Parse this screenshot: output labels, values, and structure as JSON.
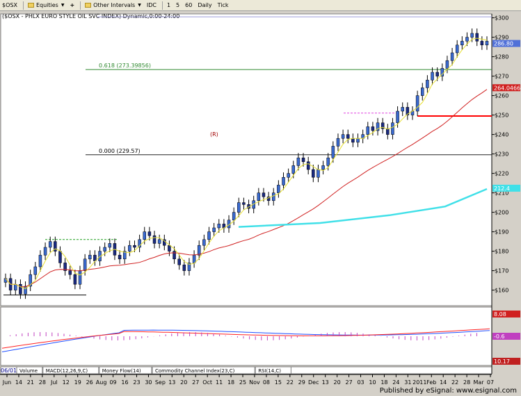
{
  "toolbar": {
    "items": [
      {
        "label": "$OSX",
        "icon": "chart-icon"
      },
      {
        "label": "Equities",
        "icon": "folder-icon",
        "dropdown": true
      },
      {
        "label": "+",
        "icon": "plus-icon"
      },
      {
        "label": "Other Intervals",
        "icon": "folder-icon",
        "dropdown": true
      },
      {
        "label": "IDC",
        "icon": "gear-icon"
      },
      {
        "label": "1"
      },
      {
        "label": "5"
      },
      {
        "label": "60"
      },
      {
        "label": "Daily"
      },
      {
        "label": "Tick"
      }
    ]
  },
  "chart_title": "($OSX - PHLX EURO STYLE OIL SVC INDEX) Dynamic,0:00-24:00",
  "annotations": {
    "fib_618": "0.618 (273.39856)",
    "fib_000": "0.000 (229.57)",
    "bracket_r": "(R)"
  },
  "price_labels": {
    "last": "286.80",
    "ma_short": "264.0466",
    "ma_long": "212.4"
  },
  "macd_labels": {
    "macd": "8.08",
    "hist": "-0.6"
  },
  "volume_label": "10.17",
  "bottom_tabs": [
    "Volume",
    "MACD(12,26,9,C)",
    "Money Flow(14)",
    "Commodity Channel Index(23,C)",
    "RSI(14,C)"
  ],
  "date_start": "06/01/10",
  "x_ticks": [
    "Jun",
    "14",
    "21",
    "28",
    "Jul",
    "12",
    "19",
    "26",
    "Aug",
    "09",
    "16",
    "23",
    "30",
    "Sep",
    "13",
    "20",
    "27",
    "Oct",
    "11",
    "18",
    "25",
    "Nov",
    "08",
    "15",
    "22",
    "29",
    "Dec",
    "13",
    "20",
    "27",
    "03",
    "10",
    "18",
    "24",
    "31",
    "2011",
    "Feb",
    "14",
    "22",
    "28",
    "Mar",
    "07"
  ],
  "y_ticks": [
    160,
    170,
    180,
    190,
    200,
    210,
    220,
    230,
    240,
    250,
    260,
    270,
    280,
    290,
    300
  ],
  "publisher": "Published by eSignal: www.esignal.com",
  "chart_data": {
    "type": "candlestick",
    "title": "($OSX - PHLX EURO STYLE OIL SVC INDEX) Dynamic,0:00-24:00",
    "ylim": [
      152,
      302
    ],
    "x_range": [
      "2010-06-01",
      "2011-03-07"
    ],
    "y_axis_side": "right",
    "grid": false,
    "closes": [
      166,
      160,
      163,
      158,
      162,
      168,
      172,
      178,
      182,
      185,
      180,
      174,
      170,
      168,
      163,
      170,
      176,
      178,
      175,
      180,
      182,
      184,
      178,
      176,
      180,
      183,
      182,
      186,
      190,
      188,
      184,
      186,
      183,
      180,
      176,
      173,
      170,
      174,
      178,
      183,
      186,
      190,
      192,
      194,
      192,
      196,
      200,
      205,
      204,
      202,
      206,
      210,
      208,
      206,
      210,
      214,
      218,
      220,
      224,
      228,
      226,
      222,
      218,
      222,
      224,
      228,
      234,
      238,
      240,
      238,
      236,
      238,
      240,
      244,
      242,
      246,
      243,
      240,
      246,
      252,
      254,
      250,
      252,
      260,
      264,
      268,
      272,
      270,
      274,
      278,
      282,
      286,
      288,
      290,
      292,
      288,
      286,
      288
    ],
    "horizontal_levels": [
      {
        "label": "0.618 (273.39856)",
        "value": 273.4,
        "color": "#308a30"
      },
      {
        "label": "0.000 (229.57)",
        "value": 229.57,
        "color": "#222222"
      },
      {
        "label": "",
        "value": 249.5,
        "color": "#ff0000"
      },
      {
        "label": "",
        "value": 300.5,
        "color": "#9a9ad8"
      }
    ],
    "moving_averages": [
      {
        "label": "264.0466",
        "color": "#d02020"
      },
      {
        "label": "212.4",
        "color": "#40e0e8"
      },
      {
        "label": "",
        "color": "#e8e030"
      }
    ],
    "lower_panel": {
      "type": "macd",
      "series": [
        {
          "label": "8.08",
          "color": "#2050ff"
        },
        {
          "label": "",
          "color": "#ff2020"
        }
      ]
    }
  }
}
